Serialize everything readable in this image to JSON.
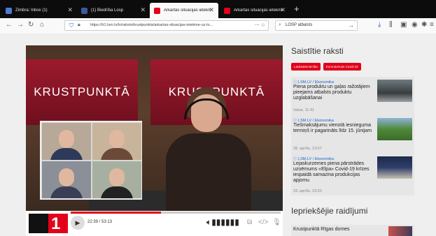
{
  "browser": {
    "tabs": [
      {
        "label": "Zimbra: Inbox (1)",
        "favicon_color": "#4f7bd1",
        "active": false
      },
      {
        "label": "(1) Biedrība Losp",
        "favicon_color": "#3b5998",
        "active": false
      },
      {
        "label": "Ārkārtas situācijas ietekme uz ...",
        "favicon_color": "#e2001a",
        "active": true
      },
      {
        "label": "Ārkārtas situācijas ietekme uz ...",
        "favicon_color": "#e2001a",
        "active": false
      }
    ],
    "new_tab": "+",
    "url": "https://lr1.lsm.lv/lv/raksts/krustpunkta/arkartas-situacijas-ietekme-uz-lo...",
    "search_value": "LOSP atbalsts"
  },
  "video": {
    "screen_text": "KRUSTPUNKTĀ",
    "time": "22:39 / 53:13",
    "progress": 0.43,
    "logo_text": "1"
  },
  "sidebar": {
    "related_title": "Saistītie raksti",
    "tags": [
      "Lauksaimniecība",
      "Koronavīruss Covid-19"
    ],
    "articles": [
      {
        "category": "ⓘ LSM.LV / Ekonomika",
        "title": "Piena produktu un gaļas ražotājiem pieejams atbalsts produktu uzglabāšanai",
        "date": "Vakar, 11:41"
      },
      {
        "category": "ⓘ LSM.LV / Ekonomika",
        "title": "Tiešmaksājumu vienotā iesnieguma termiņš ir pagarināts līdz 15. jūnijam",
        "date": "28. aprīlis, 13:07"
      },
      {
        "category": "ⓘ LSM.LV / Ekonomika",
        "title": "Lejaskurzemes piena pārstrādes uzņēmums «Elpa» Covid-19 krīzes iespaidā samazina produkcijas apjomu",
        "date": "23. aprīlis, 19:20"
      }
    ],
    "previous_title": "Iepriekšējie raidījumi",
    "previous_item": "Krustpunktā Rīgas domes"
  }
}
